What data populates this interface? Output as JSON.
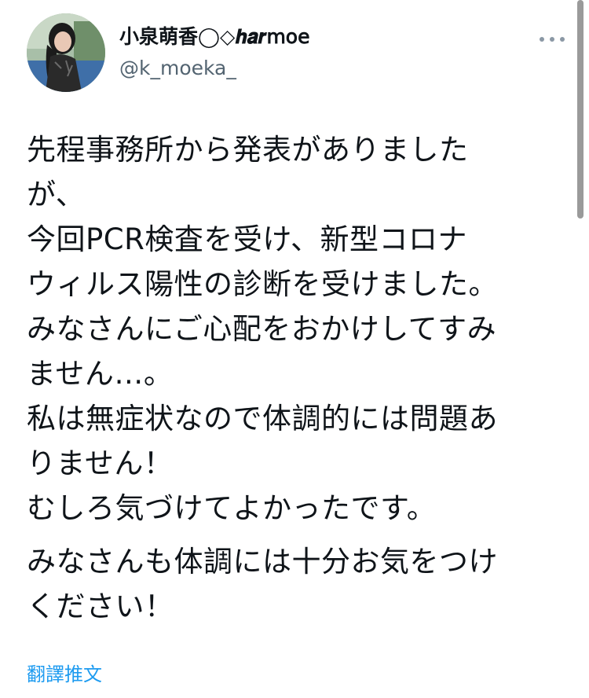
{
  "author": {
    "display_name": "小泉萌香◯◇𝒉𝒂𝒓𝗆𝗈𝖾",
    "handle": "@k_moeka_"
  },
  "tweet": {
    "lines": [
      "先程事務所から発表がありました",
      "が、",
      "今回PCR検査を受け、新型コロナ",
      "ウィルス陽性の診断を受けました。",
      "みなさんにご心配をおかけしてすみ",
      "ません…。",
      "私は無症状なので体調的には問題あ",
      "りません！",
      "むしろ気づけてよかったです。"
    ],
    "lines_after_break": [
      "みなさんも体調には十分お気をつけ",
      "ください！"
    ]
  },
  "actions": {
    "translate_label": "翻譯推文"
  },
  "colors": {
    "link": "#1d9bf0",
    "secondary_text": "#536471",
    "primary_text": "#0f1419"
  }
}
